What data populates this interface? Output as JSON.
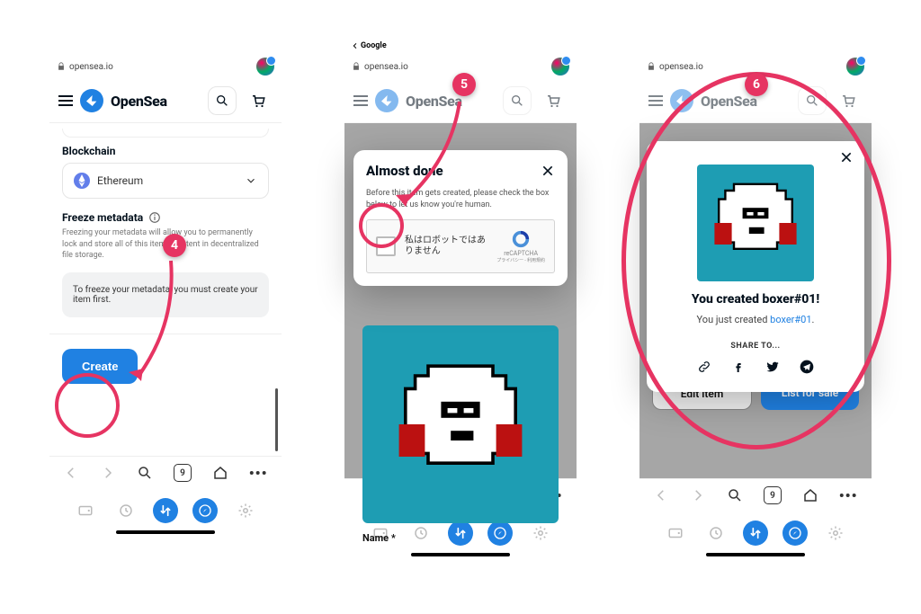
{
  "annotation": {
    "step4": "4",
    "step5": "5",
    "step6": "6"
  },
  "common": {
    "url": "opensea.io",
    "back_target": "Google",
    "brand": "OpenSea",
    "tab_count": "9"
  },
  "screen1": {
    "blockchain_label": "Blockchain",
    "blockchain_value": "Ethereum",
    "freeze_title": "Freeze metadata",
    "freeze_desc": "Freezing your metadata will allow you to permanently lock and store all of this item's content in decentralized file storage.",
    "freeze_box": "To freeze your metadata, you must create your item first.",
    "create_label": "Create"
  },
  "screen2": {
    "modal_title": "Almost done",
    "modal_sub": "Before this item gets created, please check the box below to let us know you're human.",
    "recaptcha_text": "私はロボットではありません",
    "recaptcha_brand": "reCAPTCHA",
    "recaptcha_terms": "プライバシー - 利用規約",
    "name_label": "Name *"
  },
  "screen3": {
    "created_title": "You created boxer#01!",
    "created_sub_pre": "You just created ",
    "created_link": "boxer#01",
    "created_sub_post": ".",
    "share_label": "SHARE TO...",
    "edit_label": "Edit item",
    "list_label": "List for sale"
  }
}
